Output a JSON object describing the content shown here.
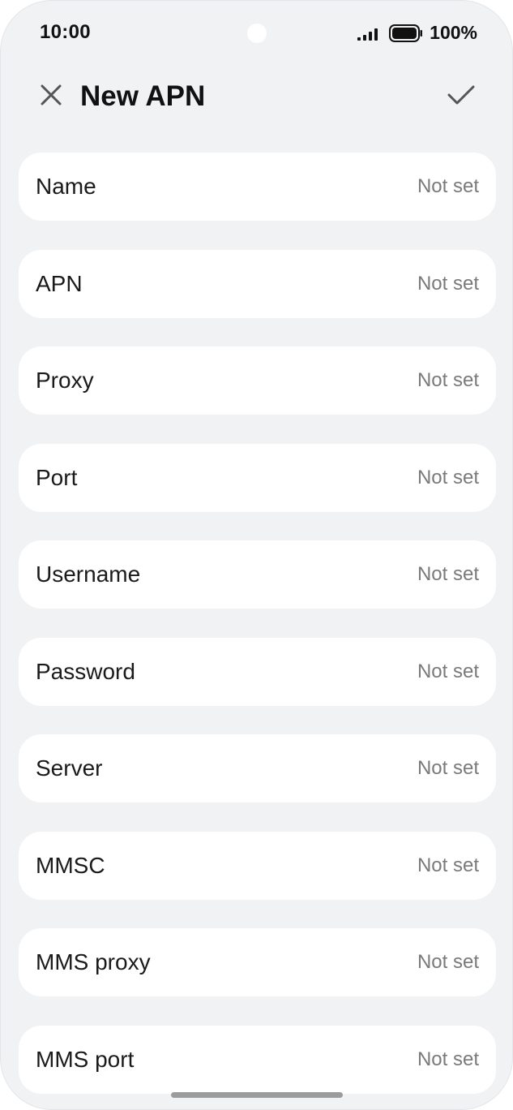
{
  "status_bar": {
    "time": "10:00",
    "battery": "100%",
    "signal_icon": "signal-bars-icon",
    "battery_icon": "battery-icon"
  },
  "app_bar": {
    "title": "New APN",
    "close_icon": "close-icon",
    "confirm_icon": "checkmark-icon"
  },
  "fields": [
    {
      "label": "Name",
      "value": "Not set"
    },
    {
      "label": "APN",
      "value": "Not set"
    },
    {
      "label": "Proxy",
      "value": "Not set"
    },
    {
      "label": "Port",
      "value": "Not set"
    },
    {
      "label": "Username",
      "value": "Not set"
    },
    {
      "label": "Password",
      "value": "Not set"
    },
    {
      "label": "Server",
      "value": "Not set"
    },
    {
      "label": "MMSC",
      "value": "Not set"
    },
    {
      "label": "MMS proxy",
      "value": "Not set"
    },
    {
      "label": "MMS port",
      "value": "Not set"
    }
  ],
  "colors": {
    "background": "#f1f2f4",
    "card": "#ffffff",
    "label_text": "#1a1a1a",
    "value_text": "#7a7a7a",
    "icon": "#555555"
  }
}
